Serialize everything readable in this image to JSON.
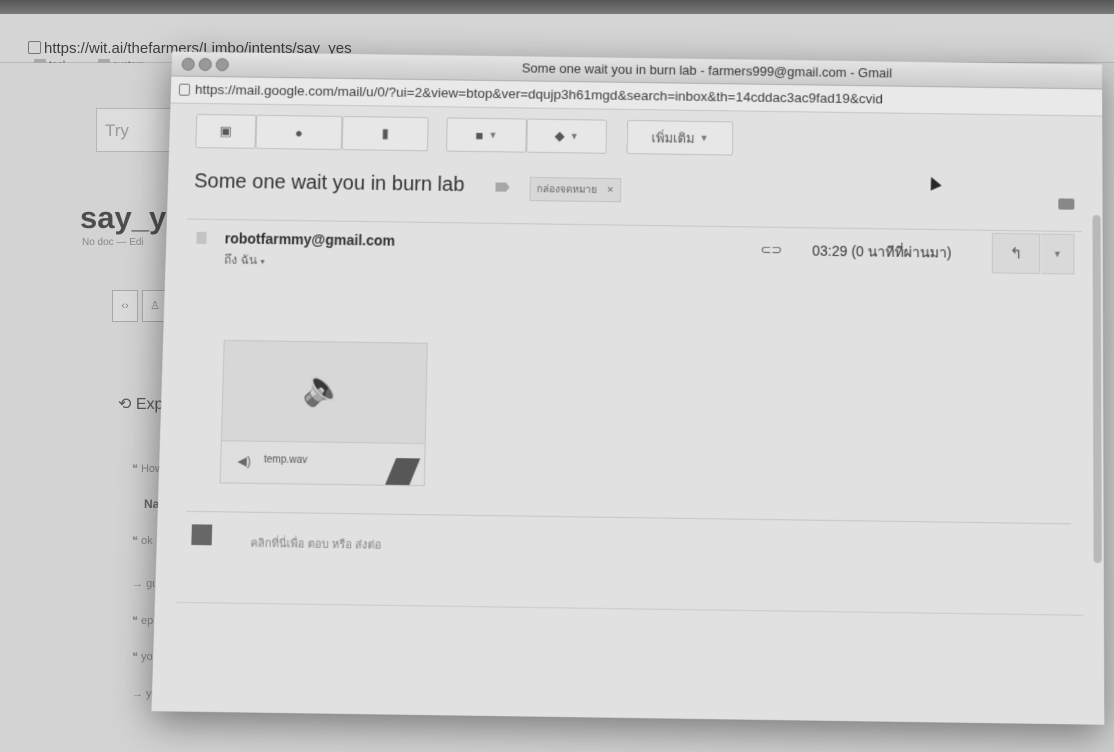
{
  "background_browser": {
    "url": "https://wit.ai/thefarmers/Limbo/intents/say_yes",
    "bookmarks": [
      "tool",
      "system"
    ],
    "search_placeholder": "Try",
    "page_title": "say_ye",
    "page_sub": "No doc — Edi",
    "expressions_label": "Expre",
    "name_header": "Name",
    "rows": [
      "How",
      "ok",
      "gu",
      "ep",
      "yo",
      "yes"
    ]
  },
  "gmail_window": {
    "title": "Some one wait you in burn lab - farmers999@gmail.com - Gmail",
    "url": "https://mail.google.com/mail/u/0/?ui=2&view=btop&ver=dqujp3h61mgd&search=inbox&th=14cddac3ac9fad19&cvid",
    "toolbar": {
      "archive_icon": "archive-icon",
      "spam_icon": "spam-icon",
      "delete_icon": "trash-icon",
      "move_icon": "folder-icon",
      "labels_icon": "label-icon",
      "more_label": "เพิ่มเติม"
    },
    "subject": "Some one wait you in burn lab",
    "label_chip": "กล่องจดหมาย",
    "label_close": "×",
    "message": {
      "sender": "robotfarmmy@gmail.com",
      "to": "ถึง ฉัน",
      "time": "03:29 (0 นาทีที่ผ่านมา)"
    },
    "attachment": {
      "filename": "temp.wav"
    },
    "reply_placeholder": "คลิกที่นี่เพื่อ ตอบ หรือ ส่งต่อ"
  }
}
